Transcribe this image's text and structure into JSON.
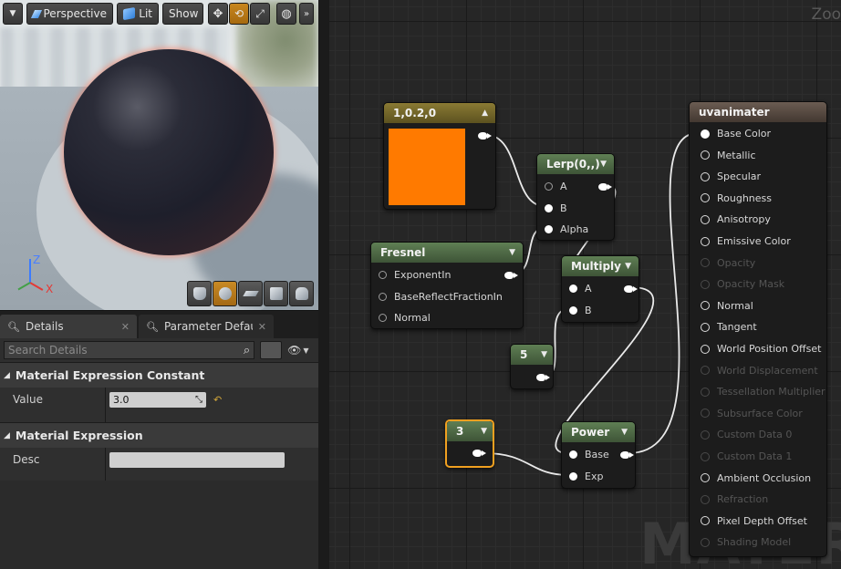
{
  "toolbar": {
    "perspective": "Perspective",
    "lit": "Lit",
    "show": "Show",
    "perspective_icon": "perspective-icon",
    "lit_icon": "cube-icon"
  },
  "viewport": {
    "axis_z": "Z",
    "axis_x": "X"
  },
  "details": {
    "tab_details": "Details",
    "tab_params": "Parameter Defaults",
    "search_placeholder": "Search Details",
    "cat_constant": "Material Expression Constant",
    "value_label": "Value",
    "value": "3.0",
    "cat_expression": "Material Expression",
    "desc_label": "Desc",
    "desc_value": ""
  },
  "graph": {
    "zoom": "Zoo",
    "watermark": "MATERIA",
    "const3_title": "1,0.2,0",
    "const3_color": "#ff7a00",
    "lerp_title": "Lerp(0,,)",
    "lerp_pins": [
      "A",
      "B",
      "Alpha"
    ],
    "fresnel_title": "Fresnel",
    "fresnel_pins": [
      "ExponentIn",
      "BaseReflectFractionIn",
      "Normal"
    ],
    "multiply_title": "Multiply",
    "multiply_pins": [
      "A",
      "B"
    ],
    "five_title": "5",
    "three_title": "3",
    "power_title": "Power",
    "power_pins": [
      "Base",
      "Exp"
    ],
    "material_title": "uvanimater",
    "material_pins": [
      {
        "label": "Base Color",
        "state": "connected"
      },
      {
        "label": "Metallic",
        "state": "active"
      },
      {
        "label": "Specular",
        "state": "active"
      },
      {
        "label": "Roughness",
        "state": "active"
      },
      {
        "label": "Anisotropy",
        "state": "active"
      },
      {
        "label": "Emissive Color",
        "state": "active"
      },
      {
        "label": "Opacity",
        "state": "disabled"
      },
      {
        "label": "Opacity Mask",
        "state": "disabled"
      },
      {
        "label": "Normal",
        "state": "active"
      },
      {
        "label": "Tangent",
        "state": "active"
      },
      {
        "label": "World Position Offset",
        "state": "active"
      },
      {
        "label": "World Displacement",
        "state": "disabled"
      },
      {
        "label": "Tessellation Multiplier",
        "state": "disabled"
      },
      {
        "label": "Subsurface Color",
        "state": "disabled"
      },
      {
        "label": "Custom Data 0",
        "state": "disabled"
      },
      {
        "label": "Custom Data 1",
        "state": "disabled"
      },
      {
        "label": "Ambient Occlusion",
        "state": "active"
      },
      {
        "label": "Refraction",
        "state": "disabled"
      },
      {
        "label": "Pixel Depth Offset",
        "state": "active"
      },
      {
        "label": "Shading Model",
        "state": "disabled"
      }
    ]
  }
}
